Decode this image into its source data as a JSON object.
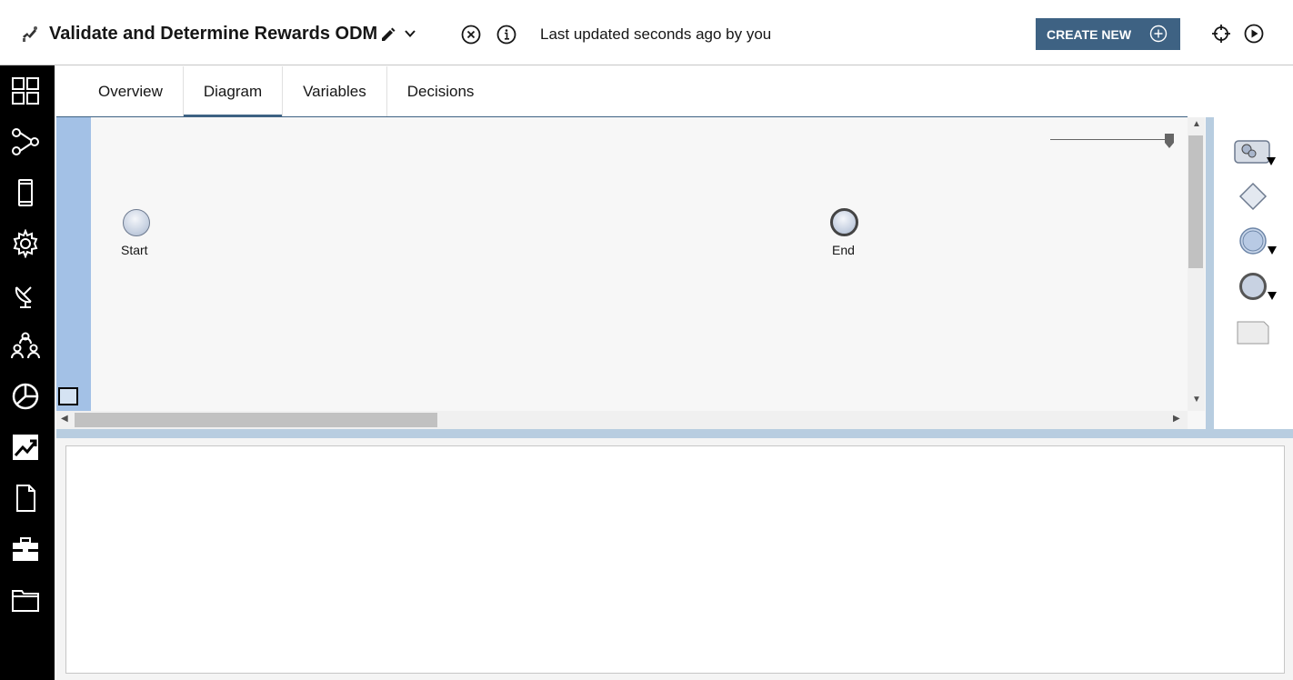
{
  "header": {
    "title": "Validate and Determine Rewards ODM",
    "status": "Last updated seconds ago by you",
    "create_new_label": "CREATE NEW"
  },
  "icons": {
    "app": "process-app-icon",
    "edit": "pencil-icon",
    "dropdown": "chevron-down-icon",
    "close": "close-circle-icon",
    "info": "info-circle-icon",
    "create": "plus-circle-icon",
    "target": "crosshair-icon",
    "run": "play-circle-icon"
  },
  "leftnav": {
    "items": [
      {
        "name": "dashboard-icon"
      },
      {
        "name": "process-icon"
      },
      {
        "name": "mobile-icon"
      },
      {
        "name": "settings-icon"
      },
      {
        "name": "satellite-dish-icon"
      },
      {
        "name": "team-icon"
      },
      {
        "name": "pie-chart-icon"
      },
      {
        "name": "trend-chart-icon"
      },
      {
        "name": "document-icon"
      },
      {
        "name": "toolbox-icon"
      },
      {
        "name": "folder-icon"
      }
    ]
  },
  "tabs": [
    {
      "label": "Overview",
      "active": false
    },
    {
      "label": "Diagram",
      "active": true
    },
    {
      "label": "Variables",
      "active": false
    },
    {
      "label": "Decisions",
      "active": false
    }
  ],
  "diagram": {
    "start_label": "Start",
    "end_label": "End"
  },
  "palette": {
    "items": [
      "activity-gear-icon",
      "gateway-diamond-icon",
      "intermediate-event-icon",
      "end-event-icon",
      "note-icon"
    ]
  },
  "colors": {
    "accent": "#3e6283",
    "lane": "#a3c1e6",
    "nav": "#000000"
  }
}
